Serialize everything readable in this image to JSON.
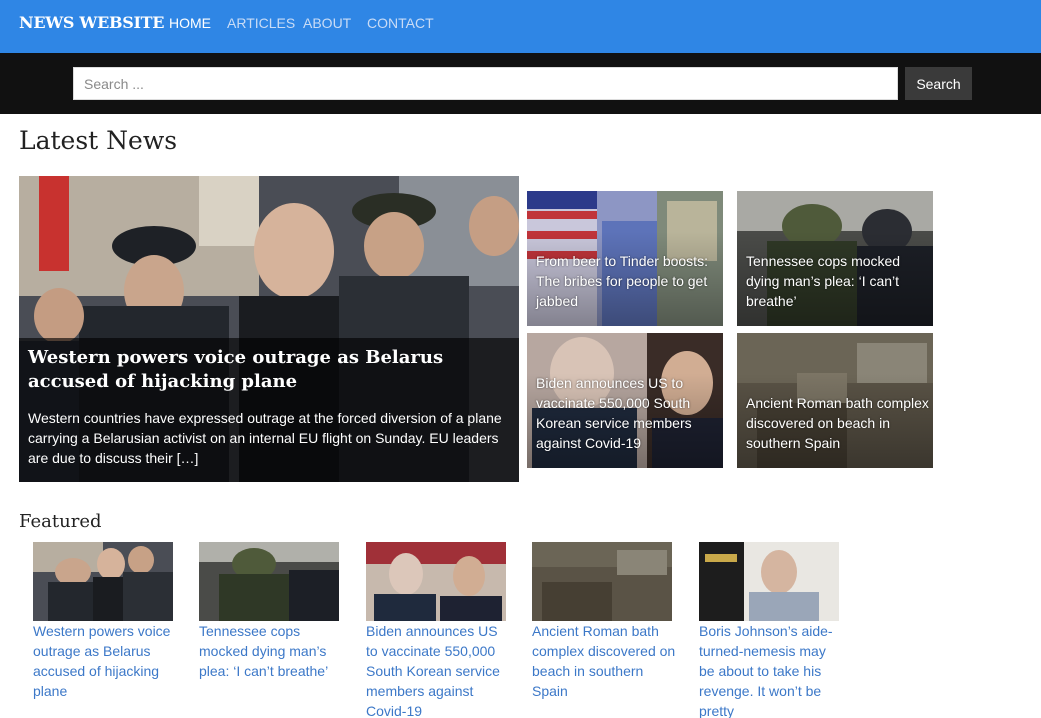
{
  "brand": "NEWS WEBSITE",
  "nav": {
    "home": "HOME",
    "articles": "ARTICLES",
    "about": "ABOUT",
    "contact": "CONTACT"
  },
  "search": {
    "placeholder": "Search ...",
    "value": "",
    "button_label": "Search"
  },
  "latest": {
    "heading": "Latest News",
    "hero": {
      "title": "Western powers voice outrage as Belarus accused of hijacking plane",
      "excerpt": "Western countries have expressed outrage at the forced diversion of a plane carrying a Belarusian activist on an internal EU flight on Sunday. EU leaders are due to discuss their […]"
    },
    "tiles": [
      {
        "title": "From beer to Tinder boosts: The bribes for people to get jabbed"
      },
      {
        "title": "Tennessee cops mocked dying man’s plea: ‘I can’t breathe’"
      },
      {
        "title": "Biden announces US to vaccinate 550,000 South Korean service members against Covid-19"
      },
      {
        "title": "Ancient Roman bath complex discovered on beach in southern Spain"
      }
    ]
  },
  "featured": {
    "heading": "Featured",
    "items": [
      {
        "title": "Western powers voice outrage as Belarus accused of hijacking plane"
      },
      {
        "title": "Tennessee cops mocked dying man’s plea: ‘I can’t breathe’"
      },
      {
        "title": "Biden announces US to vaccinate 550,000 South Korean service members against Covid-19"
      },
      {
        "title": "Ancient Roman bath complex discovered on beach in southern Spain"
      },
      {
        "title": "Boris Johnson’s aide-turned-nemesis may be about to take his revenge. It won’t be pretty"
      }
    ]
  },
  "colors": {
    "navbar": "#2f86e5",
    "searchbar": "#111111",
    "link": "#3c78c8"
  }
}
